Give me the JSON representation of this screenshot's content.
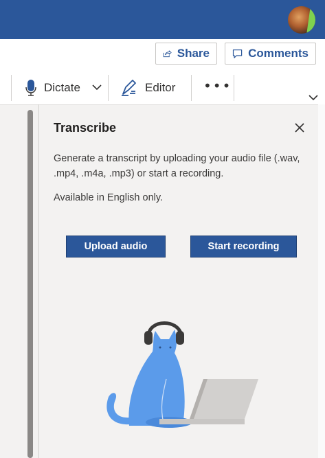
{
  "header": {
    "avatar_alt": "User avatar"
  },
  "commands": {
    "share_label": "Share",
    "comments_label": "Comments"
  },
  "ribbon": {
    "dictate_label": "Dictate",
    "editor_label": "Editor",
    "more_label": "•••"
  },
  "pane": {
    "title": "Transcribe",
    "description": "Generate a transcript by uploading your audio file (.wav, .mp4, .m4a, .mp3) or start a recording.",
    "availability_note": "Available in English only.",
    "upload_label": "Upload audio",
    "record_label": "Start recording"
  },
  "colors": {
    "brand": "#2b579a",
    "pane_bg": "#f3f2f1",
    "illustration": "#5b9bea"
  }
}
